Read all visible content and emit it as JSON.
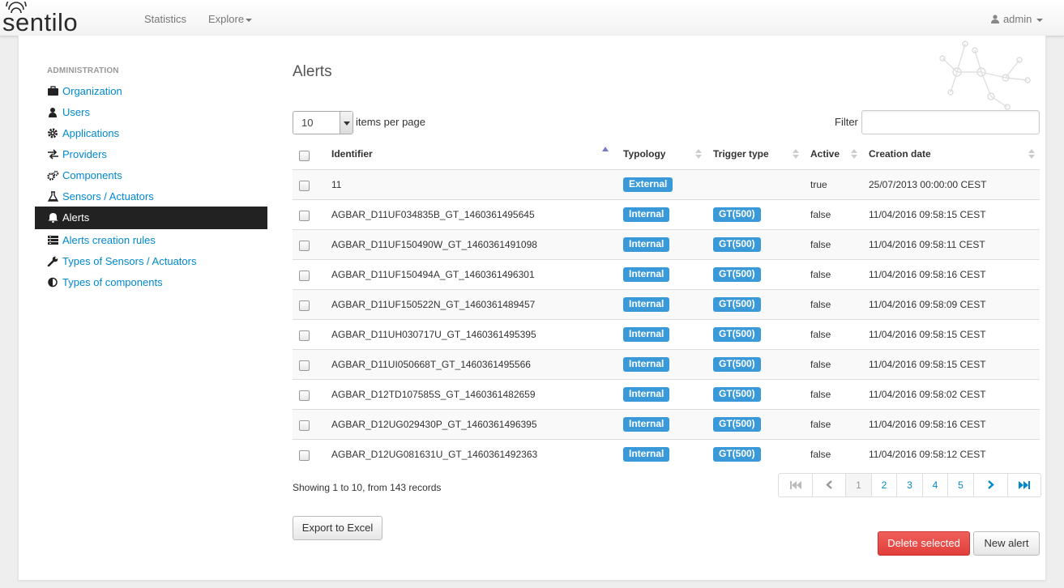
{
  "brand": {
    "logo_text": "sentilo"
  },
  "navbar": {
    "statistics": "Statistics",
    "explore": "Explore",
    "user": "admin"
  },
  "sidebar": {
    "header": "ADMINISTRATION",
    "items": [
      {
        "label": "Organization",
        "icon": "briefcase-icon"
      },
      {
        "label": "Users",
        "icon": "user-icon"
      },
      {
        "label": "Applications",
        "icon": "gear-icon"
      },
      {
        "label": "Providers",
        "icon": "exchange-icon"
      },
      {
        "label": "Components",
        "icon": "cogs-icon"
      },
      {
        "label": "Sensors / Actuators",
        "icon": "flask-icon"
      },
      {
        "label": "Alerts",
        "icon": "bell-icon",
        "active": true
      },
      {
        "label": "Alerts creation rules",
        "icon": "list-icon"
      },
      {
        "label": "Types of Sensors / Actuators",
        "icon": "wrench-icon"
      },
      {
        "label": "Types of components",
        "icon": "contrast-icon"
      }
    ]
  },
  "main": {
    "title": "Alerts",
    "per_page_value": "10",
    "per_page_label": "items per page",
    "filter_label": "Filter",
    "filter_value": ""
  },
  "table": {
    "columns": [
      "Identifier",
      "Typology",
      "Trigger type",
      "Active",
      "Creation date"
    ],
    "rows": [
      {
        "identifier": "11",
        "typology": "External",
        "trigger": "",
        "active": "true",
        "date": "25/07/2013 00:00:00 CEST"
      },
      {
        "identifier": "AGBAR_D11UF034835B_GT_1460361495645",
        "typology": "Internal",
        "trigger": "GT(500)",
        "active": "false",
        "date": "11/04/2016 09:58:15 CEST"
      },
      {
        "identifier": "AGBAR_D11UF150490W_GT_1460361491098",
        "typology": "Internal",
        "trigger": "GT(500)",
        "active": "false",
        "date": "11/04/2016 09:58:11 CEST"
      },
      {
        "identifier": "AGBAR_D11UF150494A_GT_1460361496301",
        "typology": "Internal",
        "trigger": "GT(500)",
        "active": "false",
        "date": "11/04/2016 09:58:16 CEST"
      },
      {
        "identifier": "AGBAR_D11UF150522N_GT_1460361489457",
        "typology": "Internal",
        "trigger": "GT(500)",
        "active": "false",
        "date": "11/04/2016 09:58:09 CEST"
      },
      {
        "identifier": "AGBAR_D11UH030717U_GT_1460361495395",
        "typology": "Internal",
        "trigger": "GT(500)",
        "active": "false",
        "date": "11/04/2016 09:58:15 CEST"
      },
      {
        "identifier": "AGBAR_D11UI050668T_GT_1460361495566",
        "typology": "Internal",
        "trigger": "GT(500)",
        "active": "false",
        "date": "11/04/2016 09:58:15 CEST"
      },
      {
        "identifier": "AGBAR_D12TD107585S_GT_1460361482659",
        "typology": "Internal",
        "trigger": "GT(500)",
        "active": "false",
        "date": "11/04/2016 09:58:02 CEST"
      },
      {
        "identifier": "AGBAR_D12UG029430P_GT_1460361496395",
        "typology": "Internal",
        "trigger": "GT(500)",
        "active": "false",
        "date": "11/04/2016 09:58:16 CEST"
      },
      {
        "identifier": "AGBAR_D12UG081631U_GT_1460361492363",
        "typology": "Internal",
        "trigger": "GT(500)",
        "active": "false",
        "date": "11/04/2016 09:58:12 CEST"
      }
    ]
  },
  "footer": {
    "showing": "Showing 1 to 10, from 143 records",
    "pages": [
      "1",
      "2",
      "3",
      "4",
      "5"
    ],
    "current_page": "1",
    "export": "Export to Excel",
    "delete": "Delete selected",
    "new_alert": "New alert"
  },
  "colors": {
    "accent": "#0088cc",
    "badge": "#3a9ad9",
    "danger": "#e23f3a",
    "sidebar_active": "#222222"
  }
}
